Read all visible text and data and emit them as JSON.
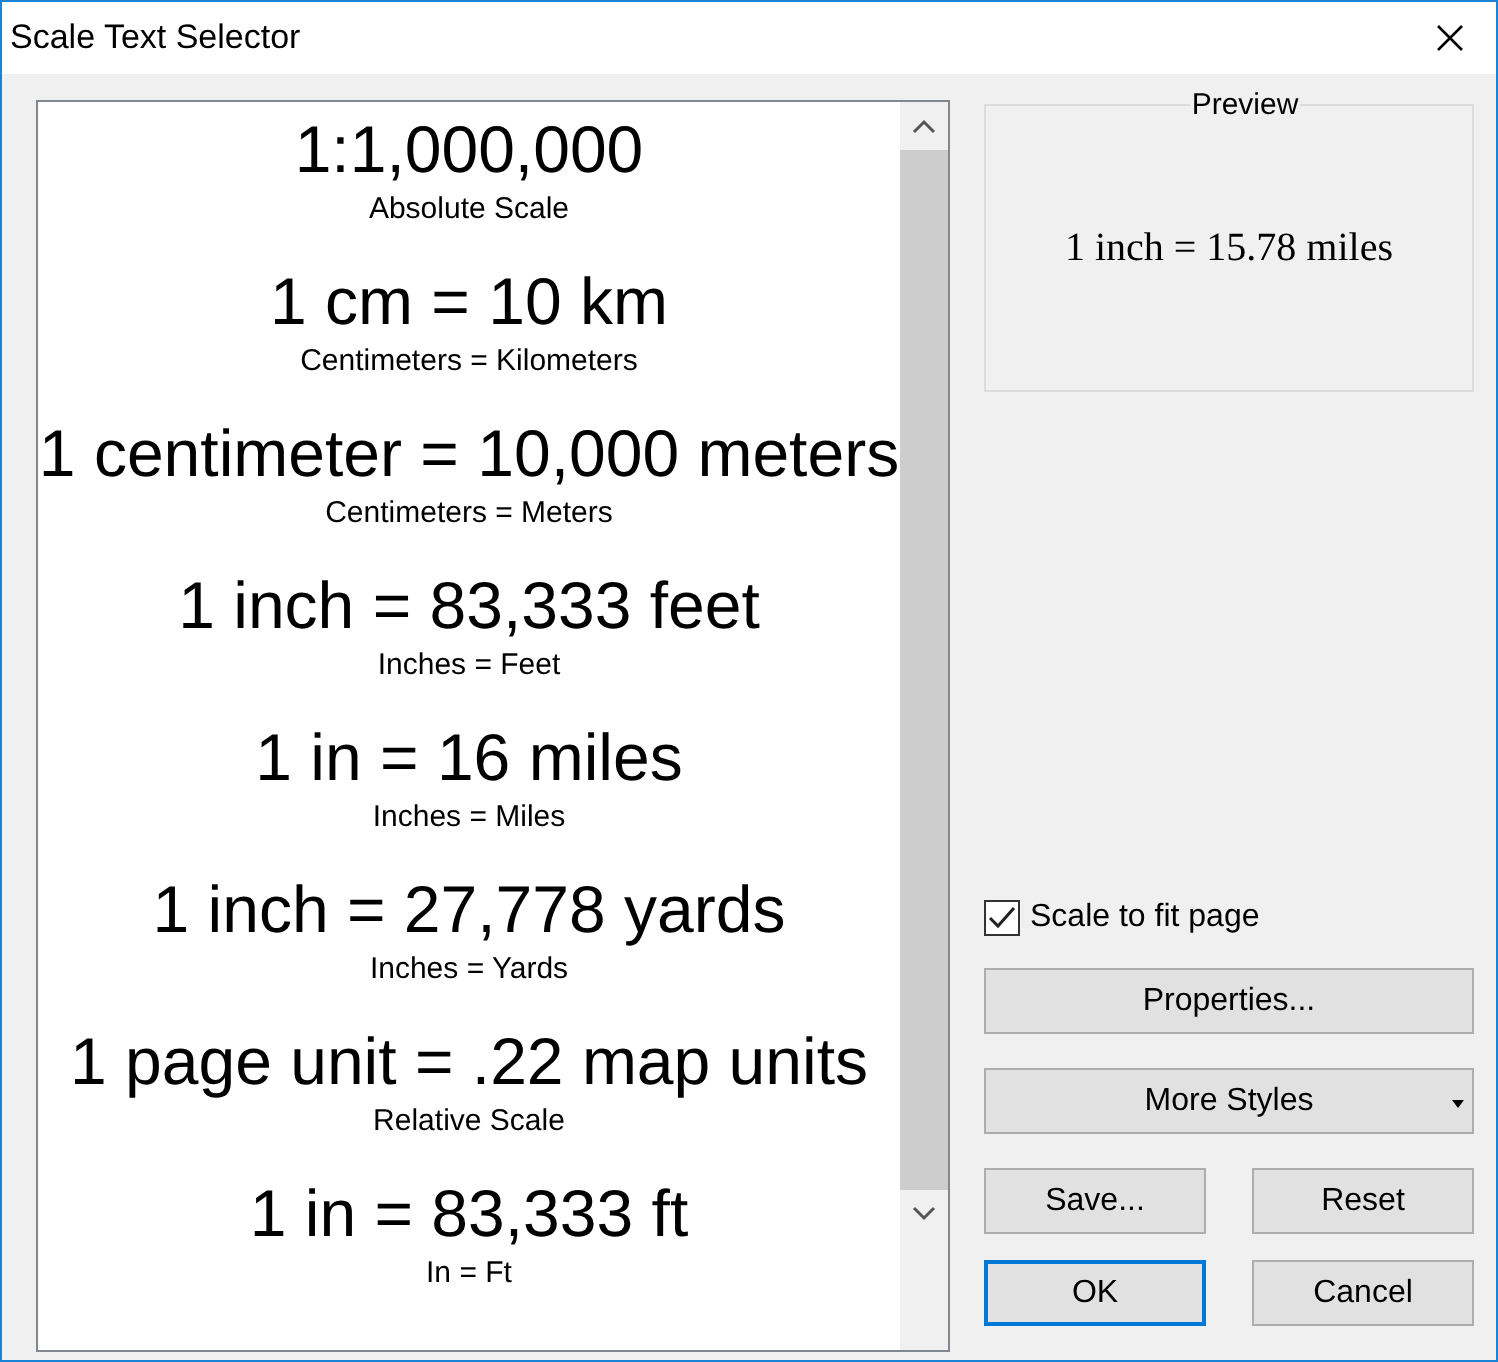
{
  "window": {
    "title": "Scale Text Selector"
  },
  "styles": [
    {
      "text": "1:1,000,000",
      "caption": "Absolute Scale"
    },
    {
      "text": "1 cm = 10 km",
      "caption": "Centimeters = Kilometers"
    },
    {
      "text": "1 centimeter = 10,000 meters",
      "caption": "Centimeters = Meters"
    },
    {
      "text": "1 inch = 83,333 feet",
      "caption": "Inches = Feet"
    },
    {
      "text": "1 in = 16 miles",
      "caption": "Inches = Miles"
    },
    {
      "text": "1 inch = 27,778 yards",
      "caption": "Inches = Yards"
    },
    {
      "text": "1 page unit = .22 map units",
      "caption": "Relative Scale"
    },
    {
      "text": "1 in = 83,333 ft",
      "caption": "In = Ft"
    }
  ],
  "preview": {
    "label": "Preview",
    "text": "1 inch = 15.78 miles"
  },
  "scale_to_fit": {
    "label": "Scale to fit page",
    "checked": true
  },
  "buttons": {
    "properties": "Properties...",
    "more_styles": "More Styles",
    "save": "Save...",
    "reset": "Reset",
    "ok": "OK",
    "cancel": "Cancel"
  }
}
